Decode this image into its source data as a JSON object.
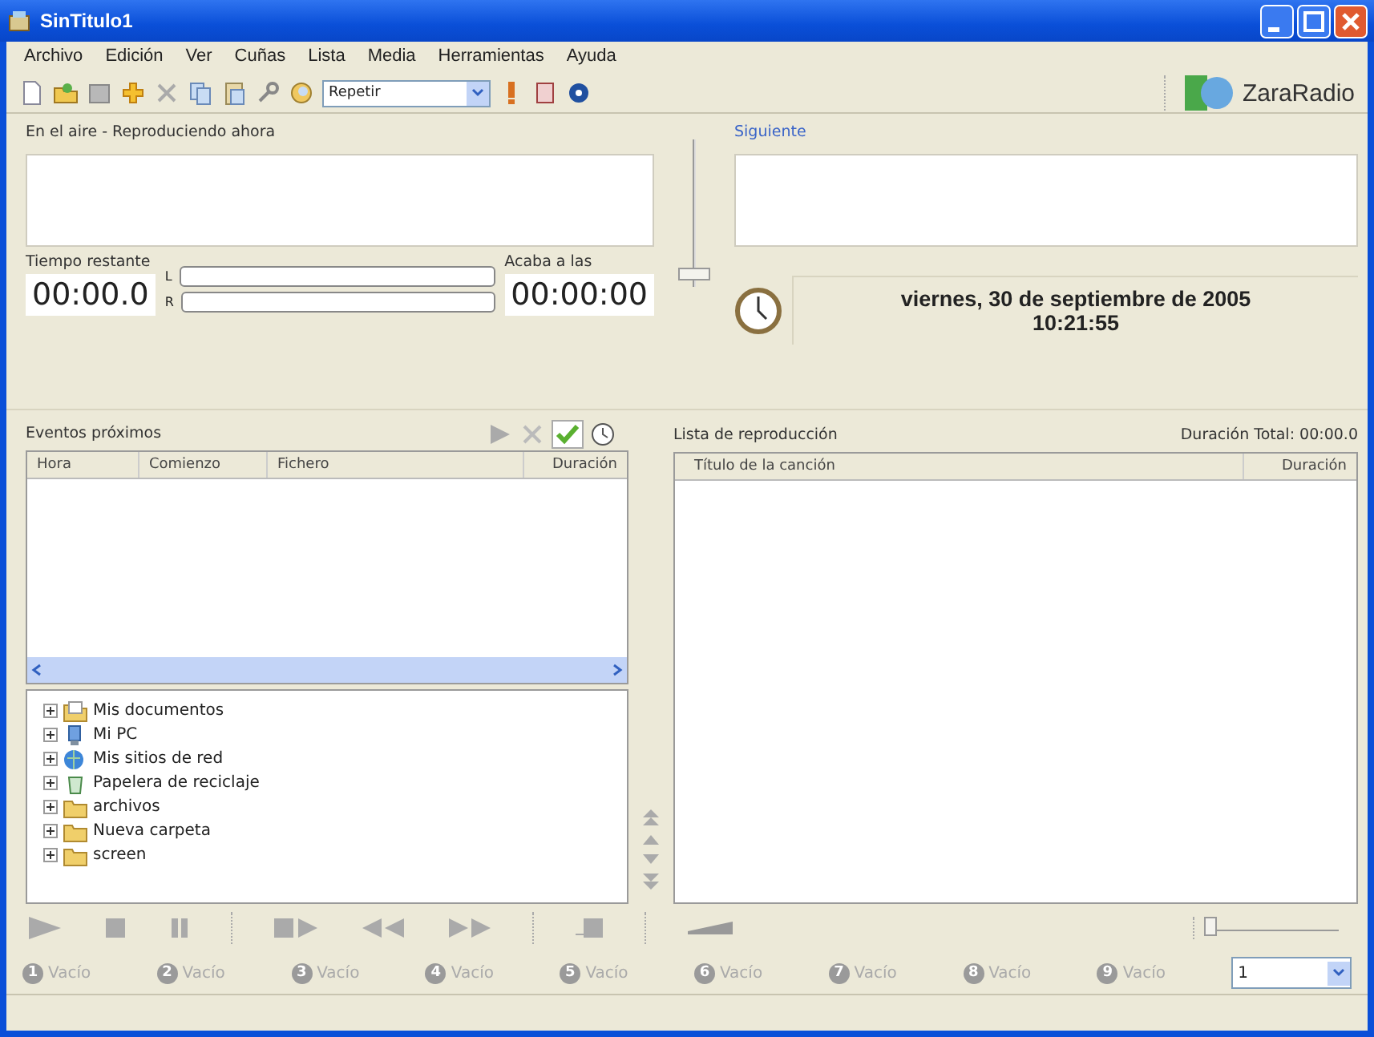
{
  "window": {
    "title": "SinTitulo1"
  },
  "menu": [
    "Archivo",
    "Edición",
    "Ver",
    "Cuñas",
    "Lista",
    "Media",
    "Herramientas",
    "Ayuda"
  ],
  "toolbar": {
    "repeat_select": {
      "value": "Repetir"
    },
    "logo": "ZaraRadio"
  },
  "on_air": {
    "title": "En el aire - Reproduciendo ahora",
    "time_remaining_label": "Tiempo restante",
    "time_remaining": "00:00.0",
    "meters": [
      {
        "label": "L",
        "level": 0
      },
      {
        "label": "R",
        "level": 0
      }
    ],
    "ends_label": "Acaba a las",
    "ends_at": "00:00:00"
  },
  "volume": {
    "level": 0.05
  },
  "next": {
    "title": "Siguiente"
  },
  "clock": {
    "date": "viernes, 30 de septiembre de 2005",
    "time": "10:21:55"
  },
  "events": {
    "title": "Eventos próximos",
    "auto_check": {
      "checked": true
    },
    "columns": [
      "Hora",
      "Comienzo",
      "Fichero",
      "Duración"
    ],
    "tree": [
      {
        "label": "Mis documentos",
        "kind": "documents",
        "expanded": false
      },
      {
        "label": "Mi PC",
        "kind": "computer",
        "expanded": false
      },
      {
        "label": "Mis sitios de red",
        "kind": "network",
        "expanded": false
      },
      {
        "label": "Papelera de reciclaje",
        "kind": "recycle",
        "expanded": false
      },
      {
        "label": "archivos",
        "kind": "folder",
        "expanded": false
      },
      {
        "label": "Nueva carpeta",
        "kind": "folder",
        "expanded": false
      },
      {
        "label": "screen",
        "kind": "folder",
        "expanded": false
      }
    ]
  },
  "playlist": {
    "title": "Lista de reproducción",
    "total": "Duración Total: 00:00.0",
    "columns": [
      "Título de la canción",
      "Duración"
    ]
  },
  "position": {
    "level": 0
  },
  "carts": [
    {
      "number": "1",
      "label": "Vacío"
    },
    {
      "number": "2",
      "label": "Vacío"
    },
    {
      "number": "3",
      "label": "Vacío"
    },
    {
      "number": "4",
      "label": "Vacío"
    },
    {
      "number": "5",
      "label": "Vacío"
    },
    {
      "number": "6",
      "label": "Vacío"
    },
    {
      "number": "7",
      "label": "Vacío"
    },
    {
      "number": "8",
      "label": "Vacío"
    },
    {
      "number": "9",
      "label": "Vacío"
    }
  ],
  "cart_page": {
    "value": "1"
  }
}
